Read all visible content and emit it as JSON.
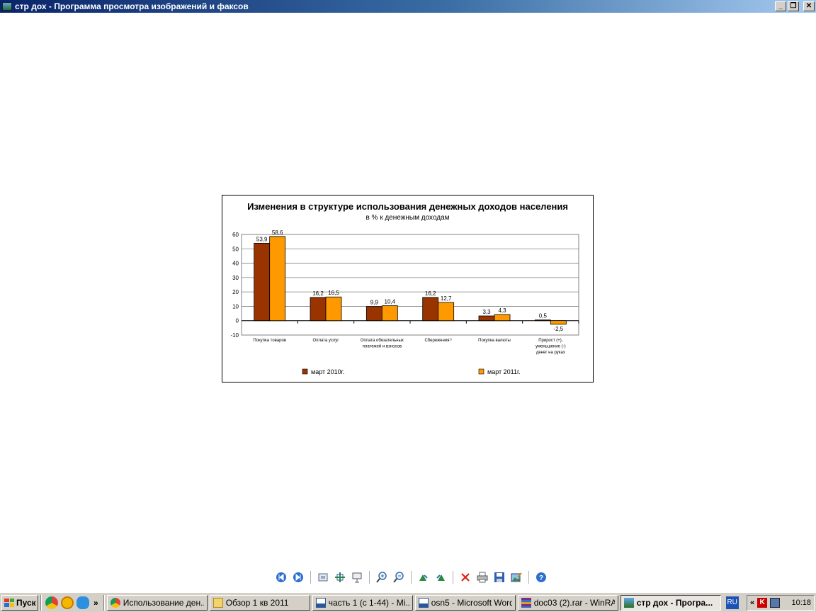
{
  "window": {
    "title": "стр дох - Программа просмотра изображений и факсов",
    "buttons": {
      "minimize": "_",
      "restore": "❐",
      "close": "✕"
    }
  },
  "chart_data": {
    "type": "bar",
    "title": "Изменения в структуре использования денежных доходов населения",
    "subtitle": "в % к денежным доходам",
    "ylim": [
      -10,
      60
    ],
    "yticks": [
      60,
      50,
      40,
      30,
      20,
      10,
      0,
      -10
    ],
    "grid": true,
    "legend_position": "bottom",
    "categories": [
      [
        "Покупка товаров"
      ],
      [
        "Оплата услуг"
      ],
      [
        "Оплата обязательных",
        "платежей и взносов"
      ],
      [
        "Сбережения¹⁾"
      ],
      [
        "Покупка валюты"
      ],
      [
        "Прирост (+),",
        "уменьшение (-)",
        "денег на руках"
      ]
    ],
    "series": [
      {
        "name": "март 2010г.",
        "color": "#993300",
        "values": [
          53.9,
          16.2,
          9.9,
          16.2,
          3.3,
          0.5
        ],
        "labels": [
          "53,9",
          "16,2",
          "9,9",
          "16,2",
          "3,3",
          "0,5"
        ]
      },
      {
        "name": "март 2011г.",
        "color": "#ff9900",
        "values": [
          58.6,
          16.5,
          10.4,
          12.7,
          4.3,
          -2.5
        ],
        "labels": [
          "58,6",
          "16,5",
          "10,4",
          "12,7",
          "4,3",
          "-2,5"
        ]
      }
    ]
  },
  "toolbar": {
    "items": [
      "prev-image",
      "next-image",
      "sep",
      "best-fit",
      "actual-size",
      "slideshow",
      "sep",
      "zoom-in",
      "zoom-out",
      "sep",
      "rotate-clockwise",
      "rotate-counterclockwise",
      "sep",
      "delete",
      "print",
      "save",
      "edit",
      "sep",
      "help"
    ]
  },
  "taskbar": {
    "start_label": "Пуск",
    "more_label": "»",
    "tasks": [
      {
        "label": "Использование ден...",
        "icon": "chrome-icon",
        "active": false
      },
      {
        "label": "Обзор 1 кв 2011",
        "icon": "folder-icon",
        "active": false
      },
      {
        "label": "часть 1 (с 1-44) - Mi...",
        "icon": "word-icon",
        "active": false
      },
      {
        "label": "osn5 - Microsoft Word",
        "icon": "word-icon",
        "active": false
      },
      {
        "label": "doc03 (2).rar - WinRAR",
        "icon": "winrar-icon",
        "active": false
      },
      {
        "label": "стр дох - Програ...",
        "icon": "image-viewer-icon",
        "active": true
      }
    ],
    "language": "RU",
    "tray_more": "«",
    "clock": "10:18"
  }
}
